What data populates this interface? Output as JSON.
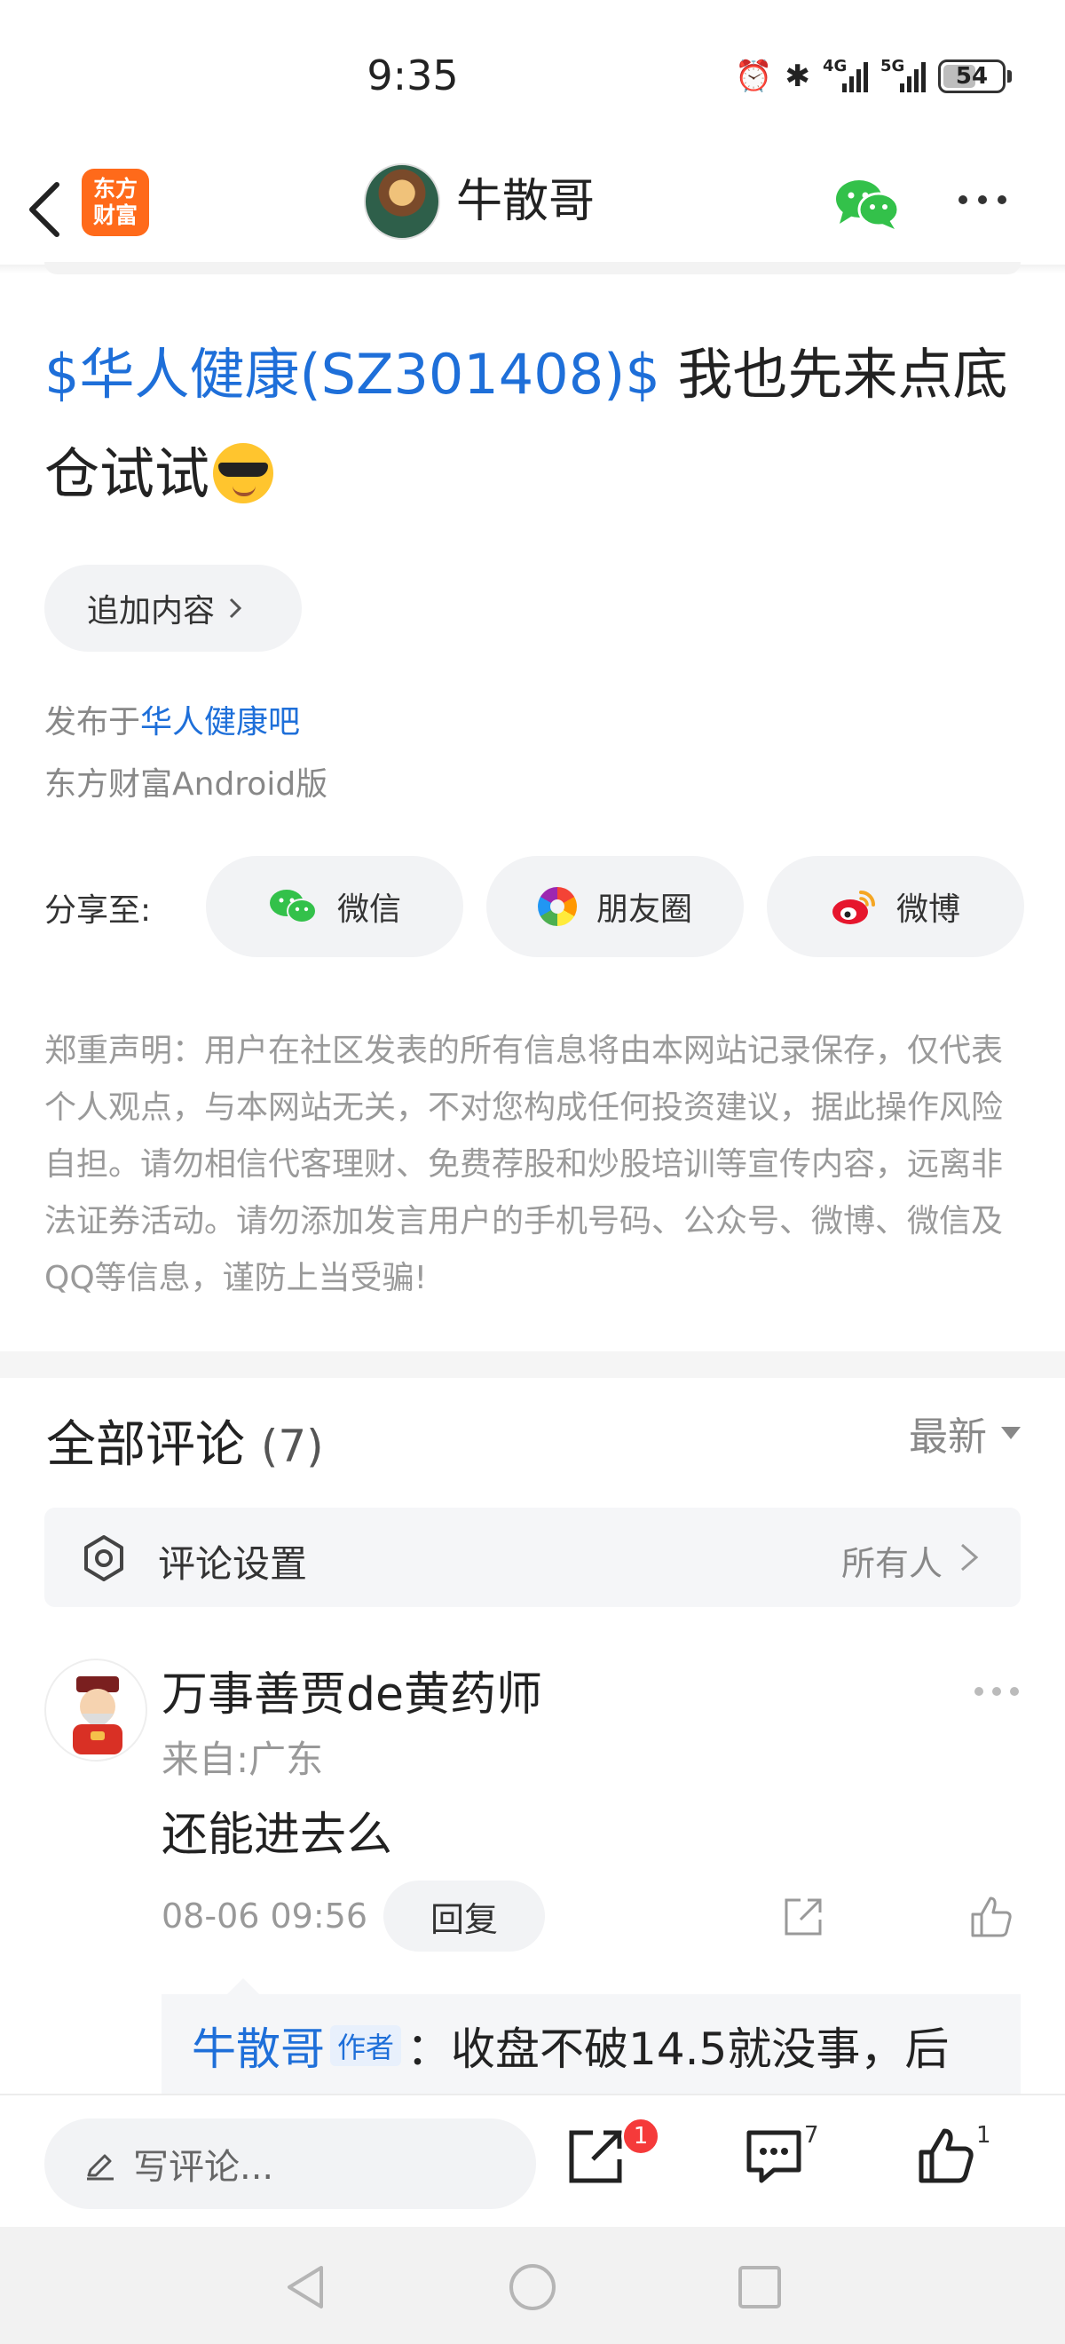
{
  "status_bar": {
    "time": "9:35",
    "signal_1": "4G",
    "signal_2": "5G",
    "battery": "54"
  },
  "header": {
    "title": "牛散哥",
    "app_logo_text": "东方财富",
    "icons": [
      "back-arrow-icon",
      "wechat-icon",
      "more-icon"
    ]
  },
  "post": {
    "stock_tag": "$华人健康(SZ301408)$",
    "body": " 我也先来点底仓试试",
    "emoji": "cool-sunglasses-emoji",
    "append_label": "追加内容",
    "published_prefix": "发布于",
    "published_bar": "华人健康吧",
    "client": "东方财富Android版"
  },
  "share": {
    "label": "分享至:",
    "wechat": "微信",
    "moments": "朋友圈",
    "weibo": "微博"
  },
  "disclaimer": "郑重声明：用户在社区发表的所有信息将由本网站记录保存，仅代表个人观点，与本网站无关，不对您构成任何投资建议，据此操作风险自担。请勿相信代客理财、免费荐股和炒股培训等宣传内容，远离非法证券活动。请勿添加发言用户的手机号码、公众号、微博、微信及QQ等信息，谨防上当受骗!",
  "comments": {
    "title": "全部评论",
    "count": "(7)",
    "sort": "最新",
    "settings_label": "评论设置",
    "settings_value": "所有人",
    "items": [
      {
        "user": "万事善贾de黄药师",
        "from": "来自:广东",
        "text": "还能进去么",
        "time": "08-06 09:56",
        "reply_label": "回复",
        "sub_reply": {
          "author": "牛散哥",
          "badge": "作者",
          "text": "：收盘不破14.5就没事，后"
        }
      }
    ]
  },
  "bottom_bar": {
    "write_placeholder": "写评论...",
    "share_badge": "1",
    "comment_count": "7",
    "like_count": "1"
  },
  "colors": {
    "link_blue": "#1e6fd9",
    "logo_orange": "#ff6a1a",
    "badge_red": "#f53a3a"
  }
}
